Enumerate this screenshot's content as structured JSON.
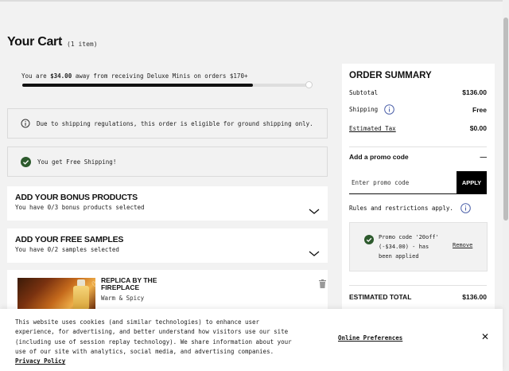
{
  "cart": {
    "title": "Your Cart",
    "item_count": "(1 item)"
  },
  "progress": {
    "prefix": "You are",
    "amount": "$34.00",
    "suffix": "away from receiving Deluxe Minis on orders $170+",
    "fraction": 0.8
  },
  "notices": {
    "shipping_regulation": "Due to shipping regulations, this order is eligible for ground shipping only.",
    "free_shipping": "You get Free Shipping!"
  },
  "bonus_products": {
    "title": "ADD YOUR BONUS PRODUCTS",
    "subtitle": "You have 0/3 bonus products selected"
  },
  "free_samples": {
    "title": "ADD YOUR FREE SAMPLES",
    "subtitle": "You have 0/2 samples selected"
  },
  "product": {
    "name": "REPLICA BY THE FIREPLACE",
    "variant": "Warm & Spicy"
  },
  "summary": {
    "title": "ORDER SUMMARY",
    "subtotal_label": "Subtotal",
    "subtotal_value": "$136.00",
    "shipping_label": "Shipping",
    "shipping_value": "Free",
    "tax_label": "Estimated Tax",
    "tax_value": "$0.00",
    "promo_heading": "Add a promo code",
    "promo_toggle": "—",
    "promo_placeholder": "Enter promo code",
    "apply_label": "APPLY",
    "rules_text": "Rules and restrictions apply.",
    "applied_text": "Promo code '20off' (-$34.00) - has been applied",
    "remove_label": "Remove",
    "estimated_total_label": "ESTIMATED TOTAL",
    "estimated_total_value": "$136.00"
  },
  "cookie_banner": {
    "text": "This website uses cookies (and similar technologies) to enhance user experience, for advertising, and better understand how visitors use our site (including use of session replay technology). We share information about your use of our site with analytics, social media, and advertising companies.",
    "policy_link": "Privacy Policy",
    "preferences_link": "Online Preferences",
    "close_label": "✕"
  },
  "colors": {
    "check_green": "#2d5a2d",
    "background": "#f2f2f2",
    "button_black": "#000000"
  },
  "icons": [
    "info-icon",
    "check-circle-icon",
    "chevron-down-icon",
    "heart-icon",
    "trash-icon",
    "close-icon"
  ]
}
